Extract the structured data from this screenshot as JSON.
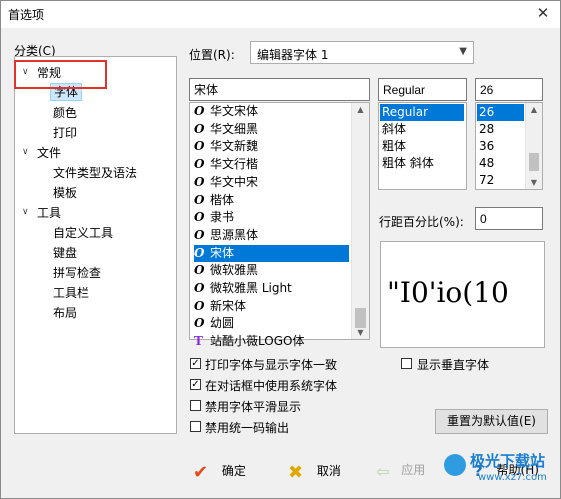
{
  "window": {
    "title": "首选项"
  },
  "categories": {
    "label": "分类(C)",
    "items": [
      {
        "label": "常规",
        "level": 0,
        "toggle": "v"
      },
      {
        "label": "字体",
        "level": 1,
        "selected": true
      },
      {
        "label": "颜色",
        "level": 1
      },
      {
        "label": "打印",
        "level": 1
      },
      {
        "label": "文件",
        "level": 0,
        "toggle": "v"
      },
      {
        "label": "文件类型及语法",
        "level": 1
      },
      {
        "label": "模板",
        "level": 1
      },
      {
        "label": "工具",
        "level": 0,
        "toggle": "v"
      },
      {
        "label": "自定义工具",
        "level": 1
      },
      {
        "label": "键盘",
        "level": 1
      },
      {
        "label": "拼写检查",
        "level": 1
      },
      {
        "label": "工具栏",
        "level": 1
      },
      {
        "label": "布局",
        "level": 1
      }
    ]
  },
  "location": {
    "label": "位置(R):",
    "value": "编辑器字体 1"
  },
  "font": {
    "value": "宋体",
    "list": [
      {
        "icon": "O",
        "name": "华文宋体"
      },
      {
        "icon": "O",
        "name": "华文细黑"
      },
      {
        "icon": "O",
        "name": "华文新魏"
      },
      {
        "icon": "O",
        "name": "华文行楷"
      },
      {
        "icon": "O",
        "name": "华文中宋"
      },
      {
        "icon": "O",
        "name": "楷体"
      },
      {
        "icon": "O",
        "name": "隶书"
      },
      {
        "icon": "O",
        "name": "思源黑体"
      },
      {
        "icon": "O",
        "name": "宋体",
        "selected": true
      },
      {
        "icon": "O",
        "name": "微软雅黑"
      },
      {
        "icon": "O",
        "name": "微软雅黑 Light"
      },
      {
        "icon": "O",
        "name": "新宋体"
      },
      {
        "icon": "O",
        "name": "幼圆"
      },
      {
        "icon": "T",
        "name": "站酷小薇LOGO体"
      }
    ]
  },
  "style": {
    "value": "Regular",
    "list": [
      {
        "name": "Regular",
        "selected": true
      },
      {
        "name": "斜体"
      },
      {
        "name": "粗体"
      },
      {
        "name": "粗体 斜体"
      }
    ]
  },
  "size": {
    "value": "26",
    "list": [
      {
        "name": "26",
        "selected": true
      },
      {
        "name": "28"
      },
      {
        "name": "36"
      },
      {
        "name": "48"
      },
      {
        "name": "72"
      }
    ]
  },
  "line_spacing": {
    "label": "行距百分比(%):",
    "value": "0"
  },
  "preview": {
    "text": "\"I0'io(10"
  },
  "options": [
    {
      "label": "打印字体与显示字体一致",
      "checked": true
    },
    {
      "label": "在对话框中使用系统字体",
      "checked": true
    },
    {
      "label": "禁用字体平滑显示",
      "checked": false
    },
    {
      "label": "禁用统一码输出",
      "checked": false
    }
  ],
  "vertical_font": {
    "label": "显示垂直字体",
    "checked": false
  },
  "buttons": {
    "reset": "重置为默认值(E)",
    "ok": "确定",
    "cancel": "取消",
    "apply": "应用",
    "help": "帮助(H)"
  },
  "watermark": {
    "brand": "极光下载站",
    "url": "www.xz7.com"
  },
  "colors": {
    "selection": "#0078d7",
    "highlight_box": "#e0332d",
    "ok_icon": "#e64a19",
    "cancel_icon": "#e0a800"
  }
}
